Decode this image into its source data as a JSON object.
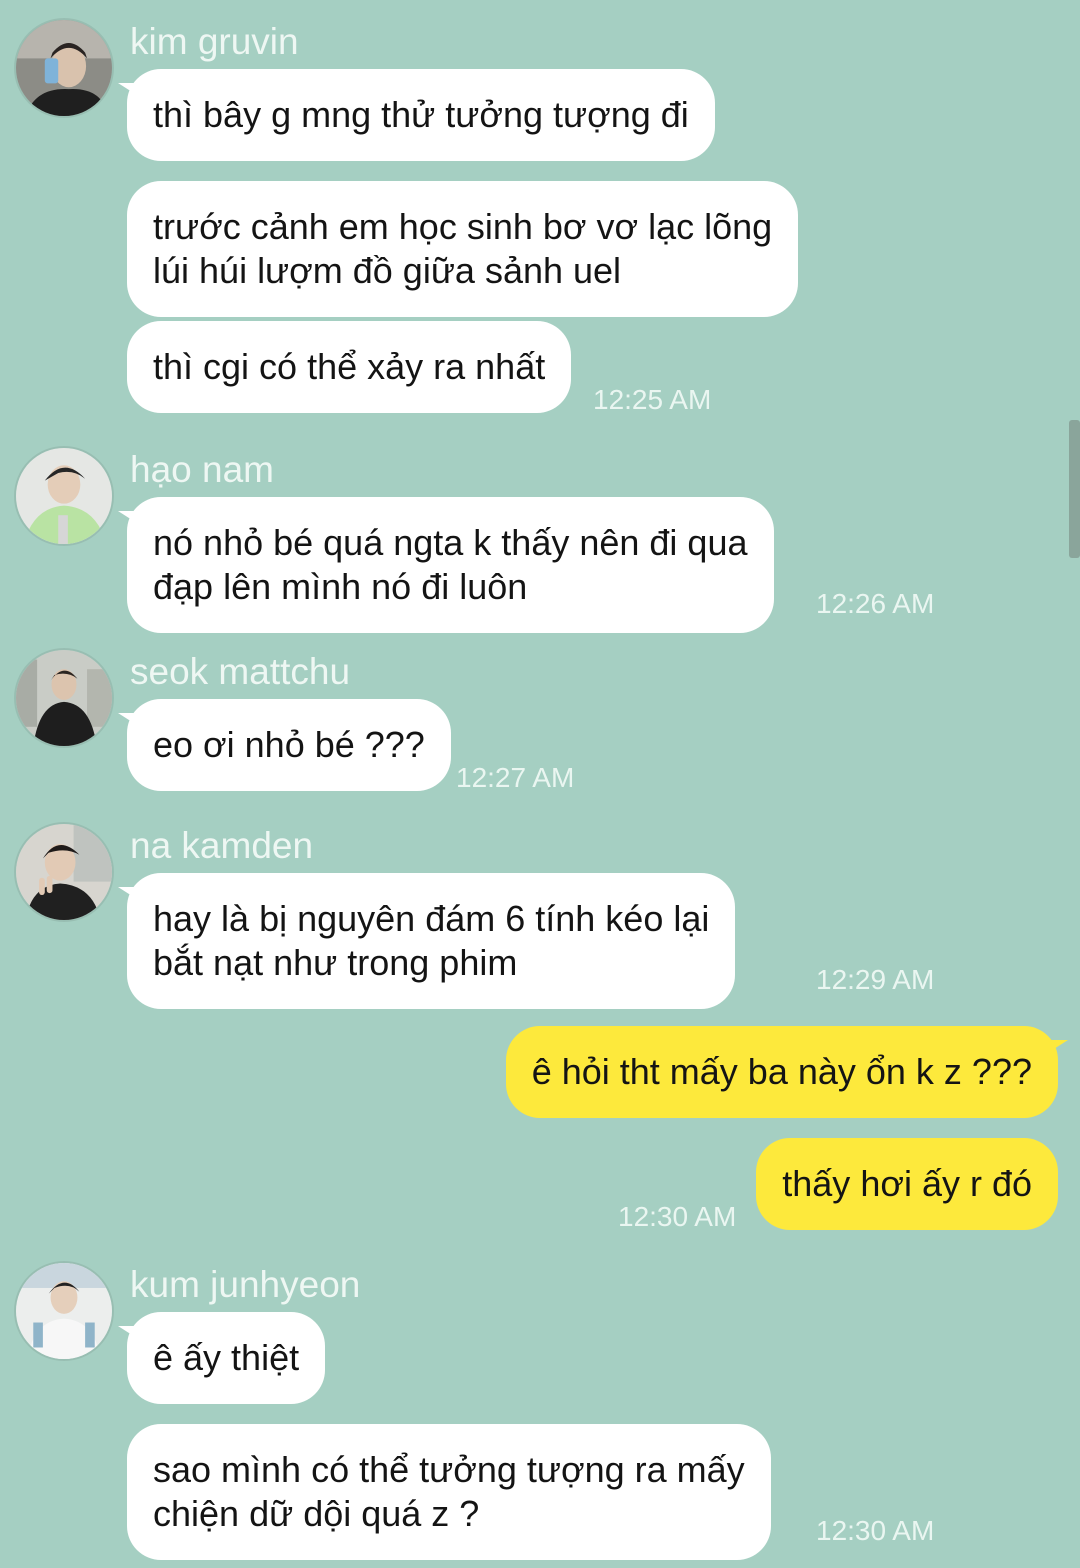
{
  "theme": {
    "background": "#a5cfc2",
    "incoming_bubble": "#ffffff",
    "outgoing_bubble": "#fde93c",
    "text": "#141414",
    "meta_text": "#eaf6f1"
  },
  "groups": [
    {
      "sender": "kim gruvin",
      "avatar_icon": "profile-photo-selfie-icon",
      "messages": [
        "thì bây g mng thử tưởng tượng đi",
        "trước cảnh em học sinh bơ vơ lạc lõng\nlúi húi lượm đồ giữa sảnh uel",
        "thì cgi có thể xảy ra nhất"
      ],
      "time": "12:25 AM"
    },
    {
      "sender": "hạo nam",
      "avatar_icon": "profile-photo-green-shirt-icon",
      "messages": [
        "nó nhỏ bé quá ngta k thấy nên đi qua\nđạp lên mình nó đi luôn"
      ],
      "time": "12:26 AM"
    },
    {
      "sender": "seok mattchu",
      "avatar_icon": "profile-photo-street-icon",
      "messages": [
        "eo ơi nhỏ bé ???"
      ],
      "time": "12:27 AM"
    },
    {
      "sender": "na kamden",
      "avatar_icon": "profile-photo-peace-sign-icon",
      "messages": [
        "hay là bị nguyên đám 6 tính kéo lại\nbắt nạt như trong phim"
      ],
      "time": "12:29 AM"
    },
    {
      "sender": "",
      "outgoing": true,
      "messages": [
        "ê hỏi tht mấy ba này ổn k z ???",
        "thấy hơi ấy r đó"
      ],
      "time": "12:30 AM"
    },
    {
      "sender": "kum junhyeon",
      "avatar_icon": "profile-photo-uniform-icon",
      "messages": [
        "ê ấy thiệt",
        "sao mình có thể tưởng tượng ra mấy\nchiện dữ dội quá z ?"
      ],
      "time": "12:30 AM"
    }
  ]
}
